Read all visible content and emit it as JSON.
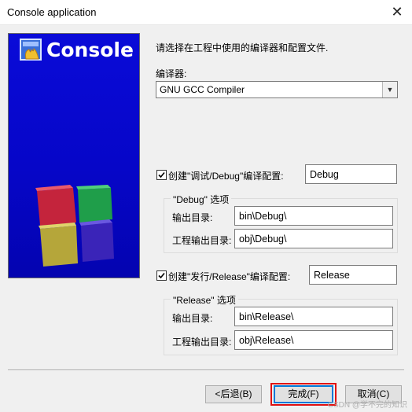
{
  "window": {
    "title": "Console application",
    "close_glyph": "✕"
  },
  "banner": {
    "logo_text": "Console"
  },
  "intro_text": "请选择在工程中使用的编译器和配置文件.",
  "compiler": {
    "label": "编译器:",
    "selected": "GNU GCC Compiler"
  },
  "debug": {
    "checkbox_label": "创建\"调试/Debug\"编译配置:",
    "checked": true,
    "config_name": "Debug",
    "group_title": "\"Debug\" 选项",
    "output_dir_label": "输出目录:",
    "output_dir": "bin\\Debug\\",
    "obj_dir_label": "工程输出目录:",
    "obj_dir": "obj\\Debug\\"
  },
  "release": {
    "checkbox_label": "创建\"发行/Release\"编译配置:",
    "checked": true,
    "config_name": "Release",
    "group_title": "\"Release\" 选项",
    "output_dir_label": "输出目录:",
    "output_dir": "bin\\Release\\",
    "obj_dir_label": "工程输出目录:",
    "obj_dir": "obj\\Release\\"
  },
  "buttons": {
    "back": "<后退(B)",
    "finish": "完成(F)",
    "cancel": "取消(C)"
  },
  "watermark": "CSDN @学不完的知识",
  "colors": {
    "banner_blue": "#0606c8",
    "focus_blue": "#0078d7",
    "highlight_red": "#e01010"
  }
}
